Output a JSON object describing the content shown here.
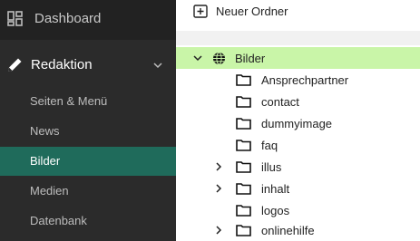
{
  "sidebar": {
    "dashboard": {
      "label": "Dashboard",
      "icon": "dashboard-grid-icon"
    },
    "redaktion": {
      "label": "Redaktion",
      "icon": "pencil-icon",
      "expand_icon": "chevron-down-icon"
    },
    "items": [
      {
        "label": "Seiten & Menü",
        "active": false
      },
      {
        "label": "News",
        "active": false
      },
      {
        "label": "Bilder",
        "active": true
      },
      {
        "label": "Medien",
        "active": false
      },
      {
        "label": "Datenbank",
        "active": false
      }
    ]
  },
  "toolbar": {
    "new_folder_label": "Neuer Ordner",
    "new_folder_icon": "plus-square-icon"
  },
  "tree": {
    "root": {
      "label": "Bilder",
      "icon": "globe-icon",
      "expanded": true,
      "selected": true
    },
    "children": [
      {
        "label": "Ansprechpartner",
        "has_children": false
      },
      {
        "label": "contact",
        "has_children": false
      },
      {
        "label": "dummyimage",
        "has_children": false
      },
      {
        "label": "faq",
        "has_children": false
      },
      {
        "label": "illus",
        "has_children": true
      },
      {
        "label": "inhalt",
        "has_children": true
      },
      {
        "label": "logos",
        "has_children": false
      },
      {
        "label": "onlinehilfe",
        "has_children": true
      }
    ]
  },
  "colors": {
    "sidebar_bg": "#2b2b2b",
    "active_item_bg": "#1f6b5b",
    "selected_row_bg": "#c9f5a8"
  }
}
